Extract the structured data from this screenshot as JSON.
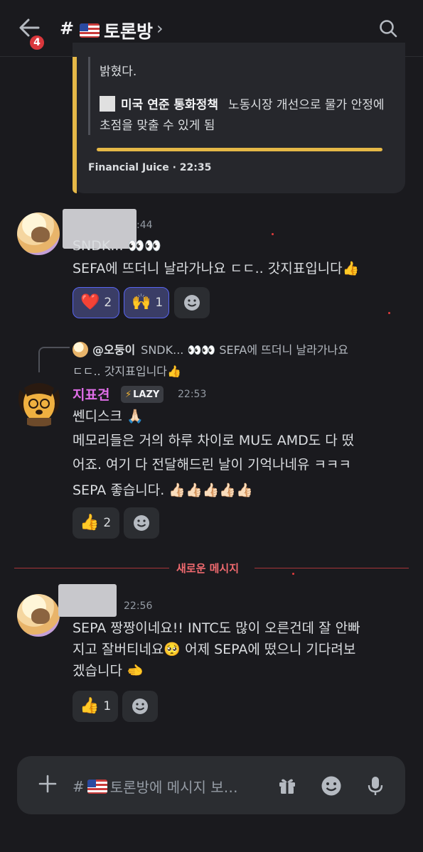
{
  "header": {
    "badge_count": "4",
    "hash": "#",
    "channel_name": "토론방",
    "chevron": "›"
  },
  "embed": {
    "line1": "밝혔다.",
    "quote_title": "미국 연준 통화정책",
    "quote_text": "노동시장 개선으로 물가 안정에 초점을 맞출 수 있게 됨",
    "footer": "Financial Juice · 22:35",
    "accent_color": "#e5b847"
  },
  "messages": [
    {
      "time": ":44",
      "text_line1": "SNDK... 👀👀",
      "text_line2": "SEFA에 뜨더니 날라가나요 ㄷㄷ.. 갓지표입니다👍",
      "reactions": [
        {
          "emoji": "❤️",
          "count": "2"
        },
        {
          "emoji": "🙌",
          "count": "1"
        }
      ]
    },
    {
      "reply": {
        "author": "@오둥이",
        "text_line1": "SNDK... 👀👀  SEFA에 뜨더니 날라가나요",
        "text_line2": "ㄷㄷ.. 갓지표입니다👍"
      },
      "author": "지표견",
      "tag": "LAZY",
      "tag_icon": "⚡",
      "time": "22:53",
      "lines": [
        "쎈디스크 🙏🏻",
        "메모리들은 거의 하루 차이로 MU도 AMD도 다 떴",
        "어죠. 여기 다 전달해드린 날이 기억나네유 ㅋㅋㅋ",
        "SEPA 좋습니다. 👍🏻👍🏻👍🏻👍🏻👍🏻"
      ],
      "reactions": [
        {
          "emoji": "👍",
          "count": "2"
        }
      ]
    },
    {
      "time": "22:56",
      "lines": [
        "SEPA 짱짱이네요!! INTC도 많이 오른건데 잘 안빠",
        "지고 잘버티네요🥺 어제 SEPA에 떴으니 기다려보",
        "겠습니다 🫲"
      ],
      "reactions": [
        {
          "emoji": "👍",
          "count": "1"
        }
      ]
    }
  ],
  "divider": {
    "label": "새로운 메시지"
  },
  "composer": {
    "placeholder_prefix": "#",
    "placeholder_text": "토론방에 메시지 보…"
  },
  "icons": {
    "back": "back-arrow-icon",
    "search": "search-icon",
    "add": "plus-icon",
    "gift": "gift-icon",
    "emoji": "emoji-icon",
    "mic": "microphone-icon"
  }
}
